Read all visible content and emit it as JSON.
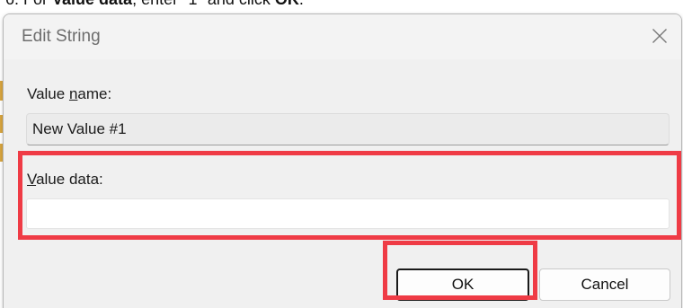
{
  "instruction": {
    "prefix": "6. For ",
    "bold_1": "Value data",
    "middle": ", enter \"1\" and click ",
    "bold_2": "OK",
    "suffix": "."
  },
  "dialog": {
    "title": "Edit String",
    "close_icon": "close-icon",
    "value_name_label_pre": "Value ",
    "value_name_label_ul": "n",
    "value_name_label_post": "ame:",
    "value_name": "New Value #1",
    "value_data_label_ul": "V",
    "value_data_label_post": "alue data:",
    "value_data": "",
    "ok_label": "OK",
    "cancel_label": "Cancel"
  },
  "colors": {
    "highlight": "#ef3b45",
    "dialog_bg": "#f0f0f0"
  }
}
